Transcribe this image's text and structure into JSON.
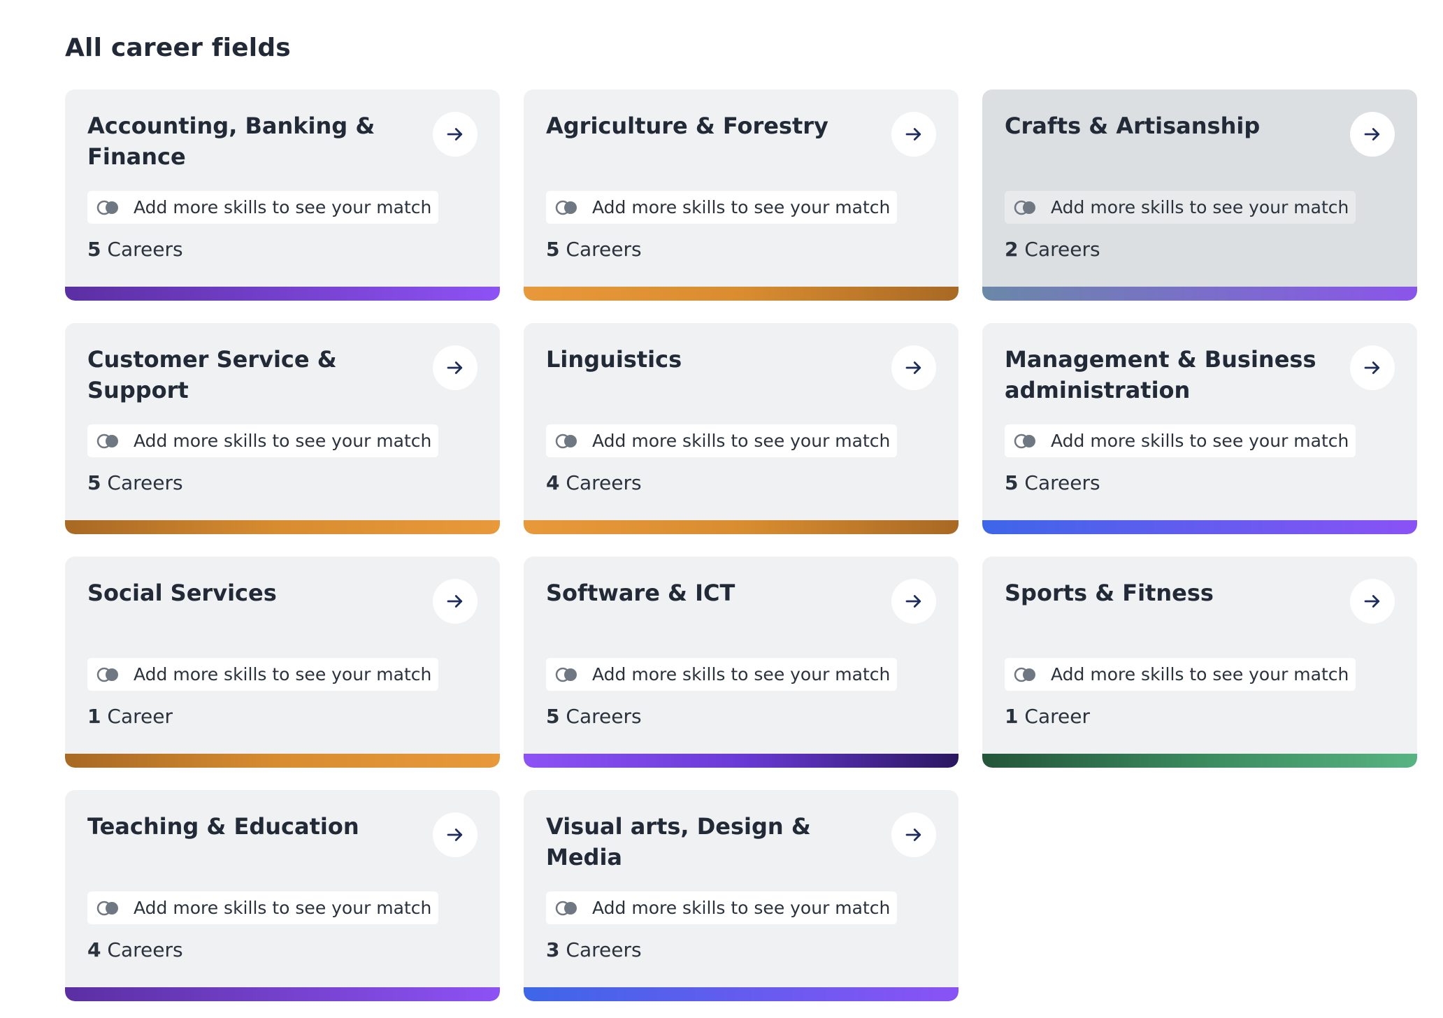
{
  "section": {
    "title": "All career fields"
  },
  "match_hint": "Add more skills to see your match",
  "icons": {
    "arrow": "arrow-right-icon",
    "match": "overlapping-circles-icon"
  },
  "colors": {
    "card_bg": "#f0f1f3",
    "card_hover_bg": "#dcdfe2",
    "title_text": "#212a36",
    "arrow_color": "#1e2d5c"
  },
  "cards": [
    {
      "title": "Accounting, Banking & Finance",
      "count": "5",
      "unit": "Careers",
      "hovered": false,
      "bar_colors": [
        "#5b2fa3",
        "#8d52f5"
      ]
    },
    {
      "title": "Agriculture & Forestry",
      "count": "5",
      "unit": "Careers",
      "hovered": false,
      "bar_colors": [
        "#e8993a",
        "#d98d30",
        "#a86924"
      ]
    },
    {
      "title": "Crafts & Artisanship",
      "count": "2",
      "unit": "Careers",
      "hovered": true,
      "bar_colors": [
        "#6a88a8",
        "#8a55ea"
      ]
    },
    {
      "title": "Customer Service & Support",
      "count": "5",
      "unit": "Careers",
      "hovered": false,
      "bar_colors": [
        "#a86924",
        "#d98d30",
        "#e8993a"
      ]
    },
    {
      "title": "Linguistics",
      "count": "4",
      "unit": "Careers",
      "hovered": false,
      "bar_colors": [
        "#e8993a",
        "#d98d30",
        "#a86924"
      ]
    },
    {
      "title": "Management & Business administration",
      "count": "5",
      "unit": "Careers",
      "hovered": false,
      "bar_colors": [
        "#3d66e8",
        "#8a52f5"
      ]
    },
    {
      "title": "Social Services",
      "count": "1",
      "unit": "Career",
      "hovered": false,
      "bar_colors": [
        "#a86924",
        "#d98d30",
        "#e8993a"
      ]
    },
    {
      "title": "Software & ICT",
      "count": "5",
      "unit": "Careers",
      "hovered": false,
      "bar_colors": [
        "#8d52f5",
        "#6a3ad6",
        "#2a1660"
      ]
    },
    {
      "title": "Sports & Fitness",
      "count": "1",
      "unit": "Career",
      "hovered": false,
      "bar_colors": [
        "#24553a",
        "#3a8a5e",
        "#58b382"
      ]
    },
    {
      "title": "Teaching & Education",
      "count": "4",
      "unit": "Careers",
      "hovered": false,
      "bar_colors": [
        "#5b2fa3",
        "#8d52f5"
      ]
    },
    {
      "title": "Visual arts, Design & Media",
      "count": "3",
      "unit": "Careers",
      "hovered": false,
      "bar_colors": [
        "#3d66e8",
        "#8a52f5"
      ]
    }
  ]
}
